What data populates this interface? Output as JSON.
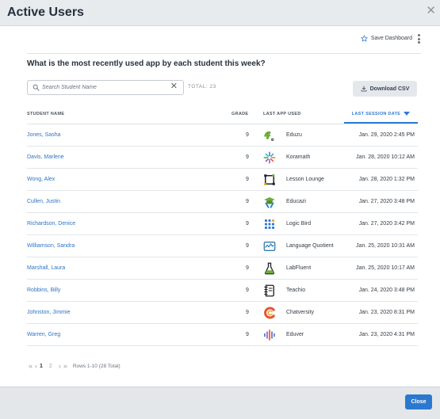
{
  "window": {
    "title": "Active Users",
    "close_glyph": "✕"
  },
  "toolbar": {
    "save_label": "Save Dashboard",
    "save_icon": "star-outline-icon",
    "menu_icon": "kebab-menu-icon"
  },
  "question": "What is the most recently used app by each student this week?",
  "search": {
    "placeholder": "Search Student Name",
    "value": "",
    "clear_glyph": "✕"
  },
  "total": "TOTAL: 23",
  "download_label": "Download CSV",
  "columns": {
    "student": "STUDENT NAME",
    "grade": "GRADE",
    "app": "LAST APP USED",
    "session": "LAST SESSION DATE"
  },
  "sort": {
    "column": "session",
    "direction": "descending"
  },
  "rows": [
    {
      "name": "Jones, Sasha",
      "grade": "9",
      "app": "Eduzu",
      "icon": "eduzu-logo-icon",
      "date": "Jan. 29, 2020 2:45 PM"
    },
    {
      "name": "Davis, Marlene",
      "grade": "9",
      "app": "Koramath",
      "icon": "koramath-logo-icon",
      "date": "Jan. 28, 2020 10:12 AM"
    },
    {
      "name": "Wong, Alex",
      "grade": "9",
      "app": "Lesson Lounge",
      "icon": "lesson-lounge-logo-icon",
      "date": "Jan. 28, 2020 1:32 PM"
    },
    {
      "name": "Cullen, Justin",
      "grade": "9",
      "app": "Educazi",
      "icon": "educazi-logo-icon",
      "date": "Jan. 27, 2020 3:48 PM"
    },
    {
      "name": "Richardson, Denice",
      "grade": "9",
      "app": "Logic Bird",
      "icon": "logic-bird-logo-icon",
      "date": "Jan. 27, 2020 3:42 PM"
    },
    {
      "name": "Williamson, Sandra",
      "grade": "9",
      "app": "Language Quotient",
      "icon": "language-quotient-logo-icon",
      "date": "Jan. 25, 2020 10:31 AM"
    },
    {
      "name": "Marshall, Laura",
      "grade": "9",
      "app": "LabFluent",
      "icon": "labfluent-logo-icon",
      "date": "Jan. 25, 2020 10:17 AM"
    },
    {
      "name": "Robbins, Billy",
      "grade": "9",
      "app": "Teachio",
      "icon": "teachio-logo-icon",
      "date": "Jan. 24, 2020 3:48 PM"
    },
    {
      "name": "Johnston, Jimmie",
      "grade": "9",
      "app": "Chatversity",
      "icon": "chatversity-logo-icon",
      "date": "Jan. 23, 2020 8:31 PM"
    },
    {
      "name": "Warren, Greg",
      "grade": "9",
      "app": "Eduver",
      "icon": "eduver-logo-icon",
      "date": "Jan. 23, 2020 4:31 PM"
    }
  ],
  "pagination": {
    "first": "«",
    "prev": "‹",
    "pages": [
      "1",
      "2"
    ],
    "current_page": "1",
    "next": "›",
    "last": "»",
    "info": "Rows 1-10 (28 Total)"
  },
  "footer": {
    "close_label": "Close"
  },
  "colors": {
    "accent": "#2b79cf",
    "link": "#2e74c4",
    "header_bg": "#e7ebee",
    "footer_bg": "#e3e7ea"
  }
}
